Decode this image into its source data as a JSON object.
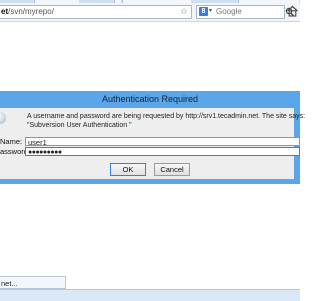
{
  "browser": {
    "url_prefix": "et",
    "url_rest": "/svn/myrepo/",
    "search_placeholder": "Google",
    "search_engine_letter": "8",
    "status_text": "net..."
  },
  "dialog": {
    "title": "Authentication Required",
    "message_line1": "A username and password are being requested by http://srv1.tecadmin.net. The site says:",
    "message_line2": "\"Subversion User Authentication \"",
    "username_label": "Name:",
    "password_label": "assword:",
    "username_value": "user1",
    "password_mask": "●●●●●●●●●",
    "ok_label": "OK",
    "cancel_label": "Cancel"
  },
  "icons": {
    "bookmark": "star-icon",
    "search": "magnifier-icon",
    "home": "home-icon",
    "dialog": "info-icon"
  },
  "colors": {
    "title_bar": "#5aa6e8",
    "dialog_bg": "#eeeeee",
    "focus_border": "#3b7ddd"
  }
}
